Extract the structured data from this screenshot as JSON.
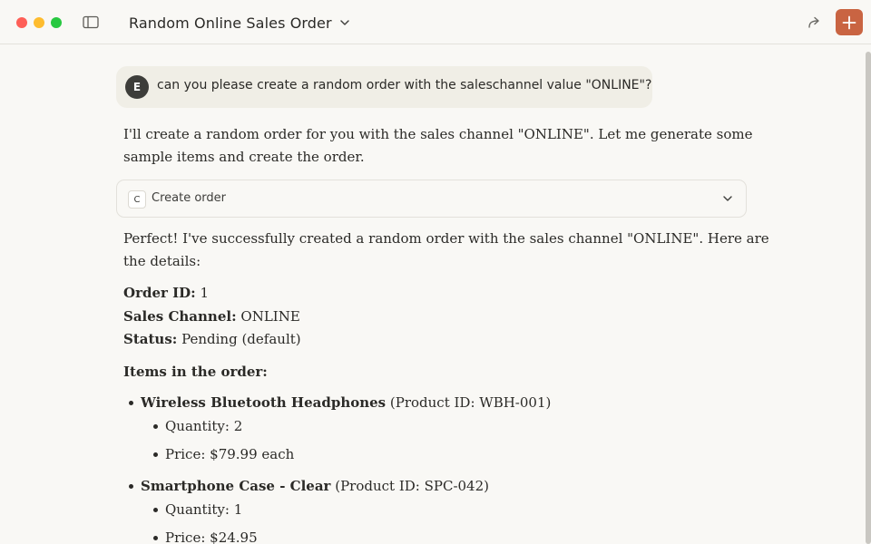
{
  "window": {
    "title": "Random Online Sales Order"
  },
  "message": {
    "avatar_initial": "E",
    "user_text": "can you please create a random order with the saleschannel value \"ONLINE\"?"
  },
  "response": {
    "intro_line1": "I'll create a random order for you with the sales channel \"ONLINE\". Let me generate some",
    "intro_line2": "sample items and create the order.",
    "tool": {
      "badge": "C",
      "label": "Create order"
    },
    "success_line1": "Perfect! I've successfully created a random order with the sales channel \"ONLINE\". Here are",
    "success_line2": "the details:",
    "order": {
      "id_label": "Order ID:",
      "id_value": " 1",
      "channel_label": "Sales Channel:",
      "channel_value": " ONLINE",
      "status_label": "Status:",
      "status_value": " Pending (default)"
    },
    "items_heading": "Items in the order:",
    "items": [
      {
        "name": "Wireless Bluetooth Headphones",
        "pid": " (Product ID: WBH-001)",
        "qty": "Quantity: 2",
        "price": "Price: $79.99 each"
      },
      {
        "name": "Smartphone Case - Clear",
        "pid": " (Product ID: SPC-042)",
        "qty": "Quantity: 1",
        "price": "Price: $24.95"
      }
    ]
  }
}
